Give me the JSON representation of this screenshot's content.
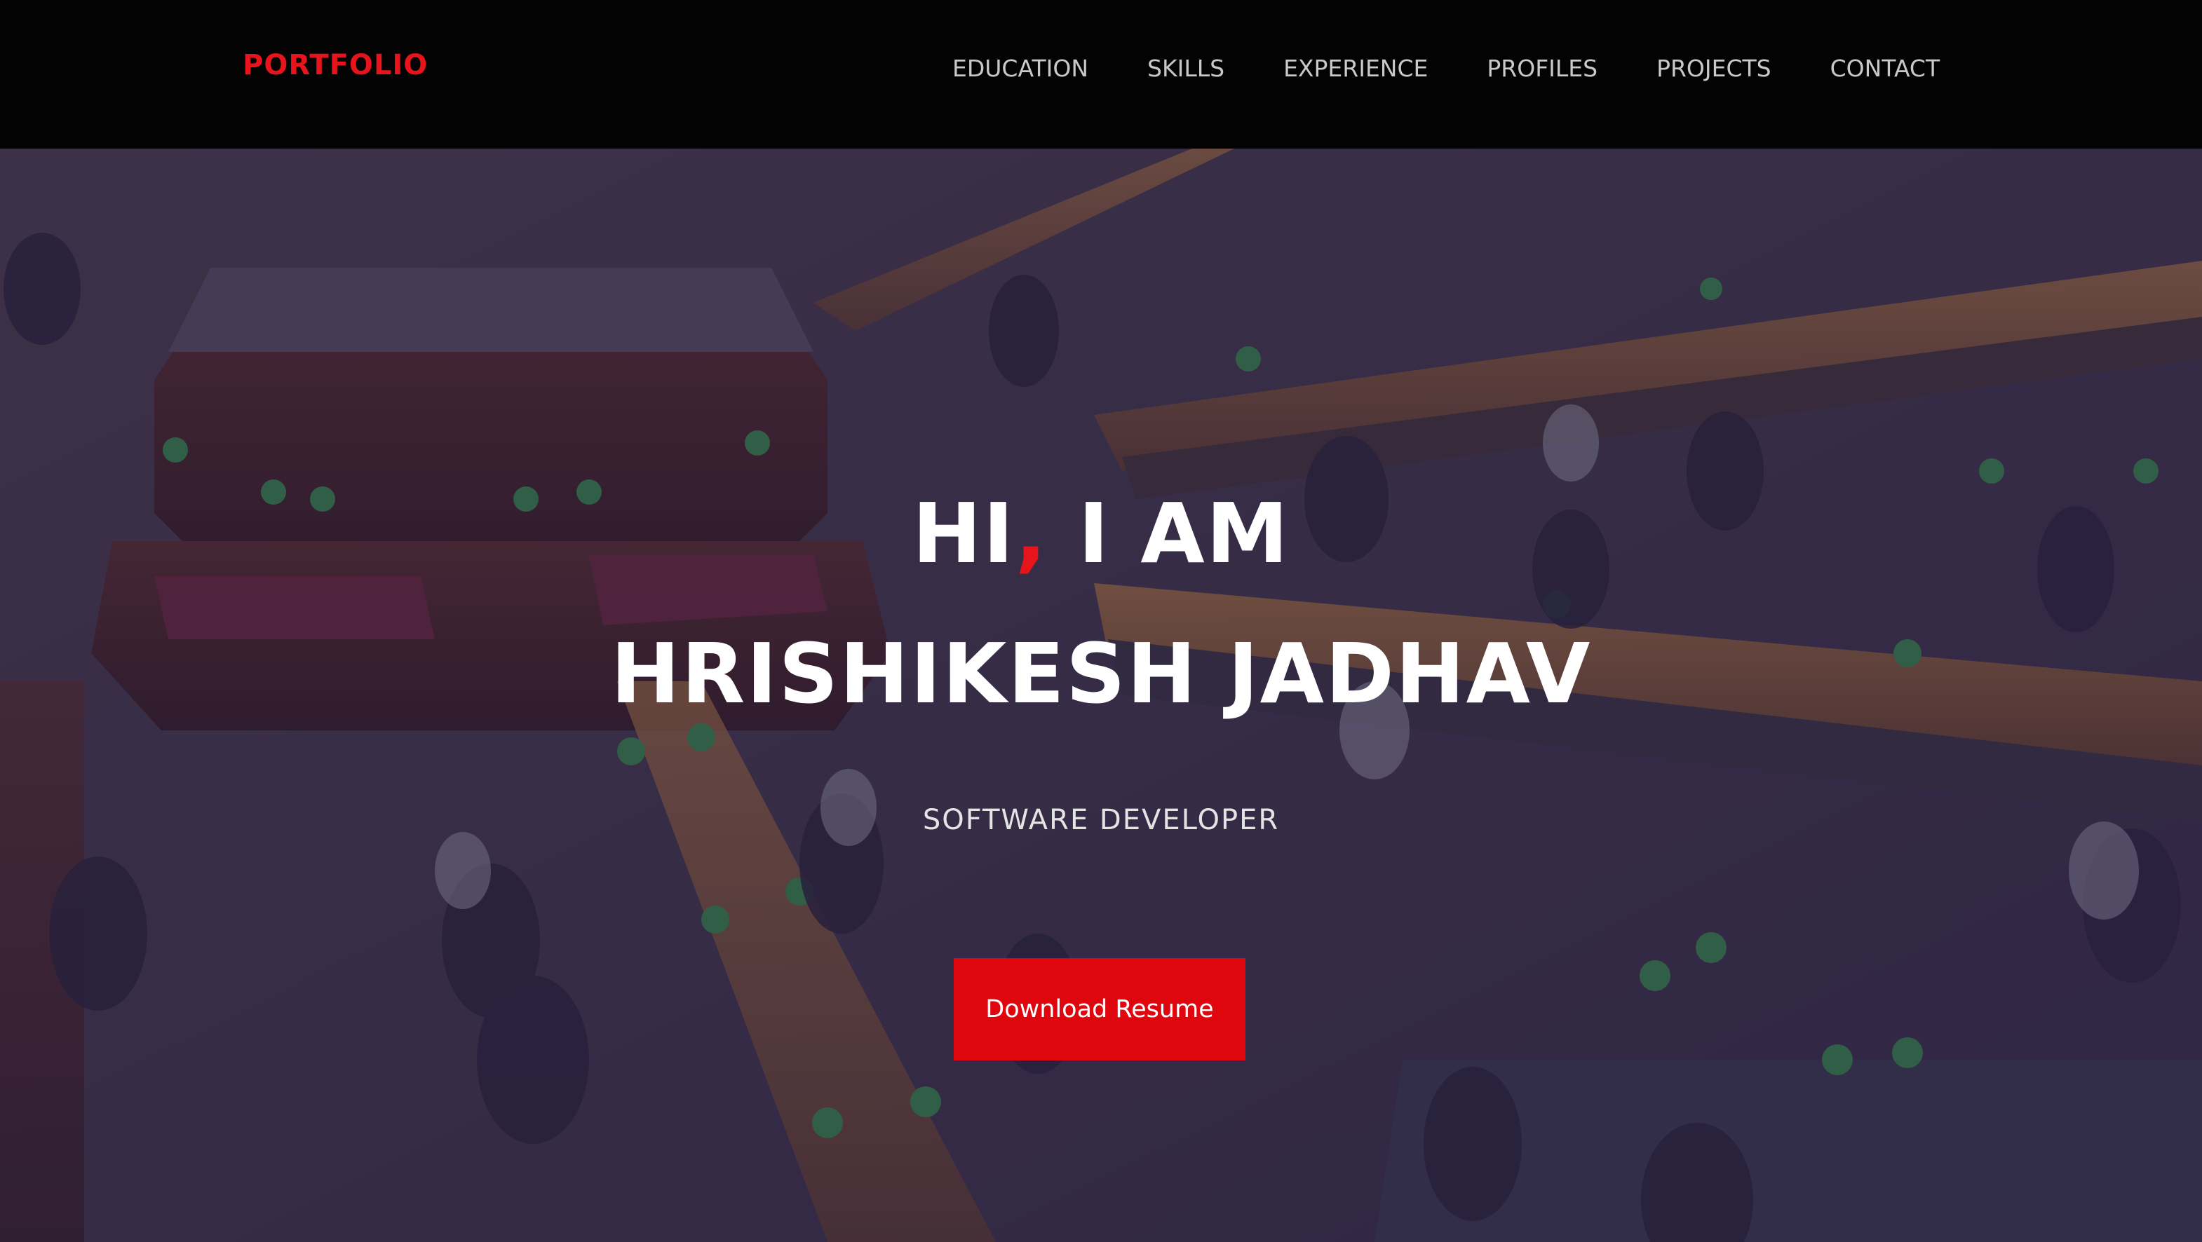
{
  "navbar": {
    "brand": "PORTFOLIO",
    "links": [
      "EDUCATION",
      "SKILLS",
      "EXPERIENCE",
      "PROFILES",
      "PROJECTS",
      "CONTACT"
    ]
  },
  "hero": {
    "greeting_prefix": "HI",
    "greeting_comma": ",",
    "greeting_suffix": " I AM",
    "name": "HRISHIKESH JADHAV",
    "role": "SOFTWARE DEVELOPER",
    "resume_button": "Download Resume",
    "background_image": "library reading room with students at long wooden desks and green lamps"
  },
  "colors": {
    "accent": "#e8141c",
    "navbar_bg": "#030303",
    "nav_text": "#c9c9c9",
    "overlay": "#261e46"
  }
}
